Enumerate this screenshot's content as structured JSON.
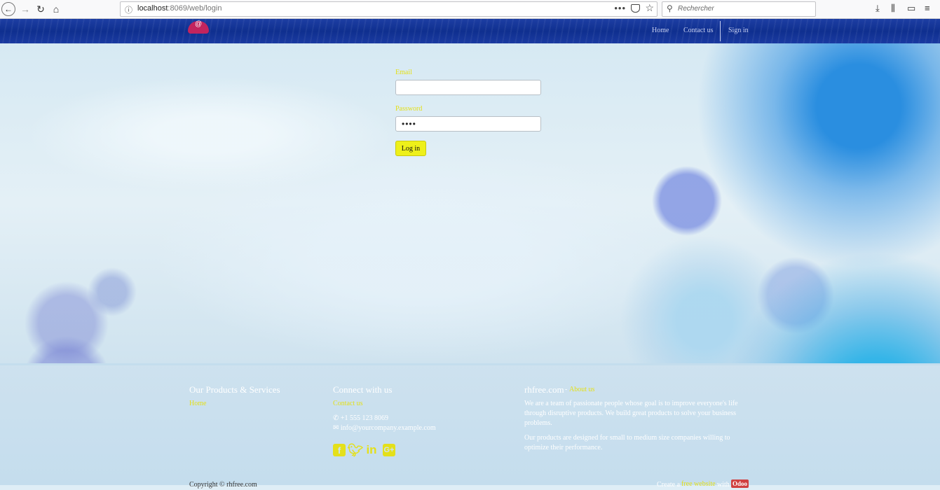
{
  "browser": {
    "url_host": "localhost",
    "url_path": ":8069/web/login",
    "search_placeholder": "Rechercher",
    "page_actions_label": "•••"
  },
  "navbar": {
    "links": [
      "Home",
      "Contact us",
      "Sign in"
    ]
  },
  "login": {
    "email_label": "Email",
    "email_value": "",
    "password_label": "Password",
    "password_value": "••••",
    "submit_label": "Log in"
  },
  "footer": {
    "products": {
      "heading": "Our Products & Services",
      "links": [
        "Home"
      ]
    },
    "connect": {
      "heading": "Connect with us",
      "contact_link": "Contact us",
      "phone": "+1 555 123 8069",
      "email": "info@yourcompany.example.com",
      "social": [
        "facebook-icon",
        "twitter-icon",
        "linkedin-icon",
        "google-plus-icon"
      ]
    },
    "about": {
      "company": "rhfree.com",
      "separator": "-",
      "about_link": "About us",
      "para1": "We are a team of passionate people whose goal is to improve everyone's life through disruptive products. We build great products to solve your business problems.",
      "para2": "Our products are designed for small to medium size companies willing to optimize their performance."
    },
    "copyright": "Copyright © rhfree.com",
    "credit_prefix": "Create a",
    "credit_link": "free website",
    "credit_with": "with",
    "credit_brand": "Odoo"
  },
  "colors": {
    "accent_yellow": "#e4e01a",
    "nav_blue": "#1a3aa0",
    "brand_red": "#d04040"
  }
}
